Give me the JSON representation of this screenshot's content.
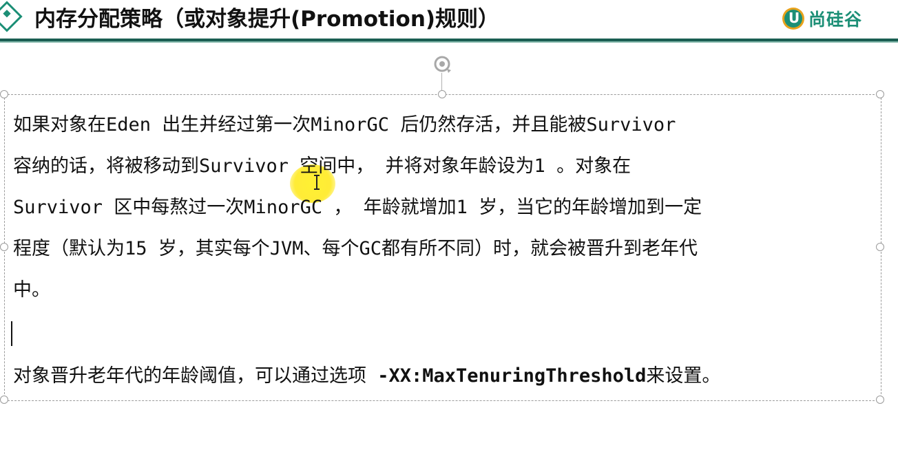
{
  "header": {
    "title": "内存分配策略（或对象提升(Promotion)规则）",
    "logo_letter": "U",
    "logo_text": "尚硅谷",
    "accent_color": "#1c8f76"
  },
  "content": {
    "lines": [
      "如果对象在Eden 出生并经过第一次MinorGC 后仍然存活，并且能被Survivor",
      "容纳的话，将被移动到Survivor 空间中， 并将对象年龄设为1 。对象在",
      "Survivor 区中每熬过一次MinorGC ， 年龄就增加1 岁，当它的年龄增加到一定",
      "程度（默认为15 岁，其实每个JVM、每个GC都有所不同）时，就会被晋升到老年代",
      "中。"
    ],
    "threshold_prefix": "对象晋升老年代的年龄阈值，可以通过选项 ",
    "threshold_option": "-XX:MaxTenuringThreshold",
    "threshold_suffix": "来设置。"
  },
  "icons": {
    "rotate": "rotate-handle-icon",
    "cursor": "text-cursor-icon"
  }
}
